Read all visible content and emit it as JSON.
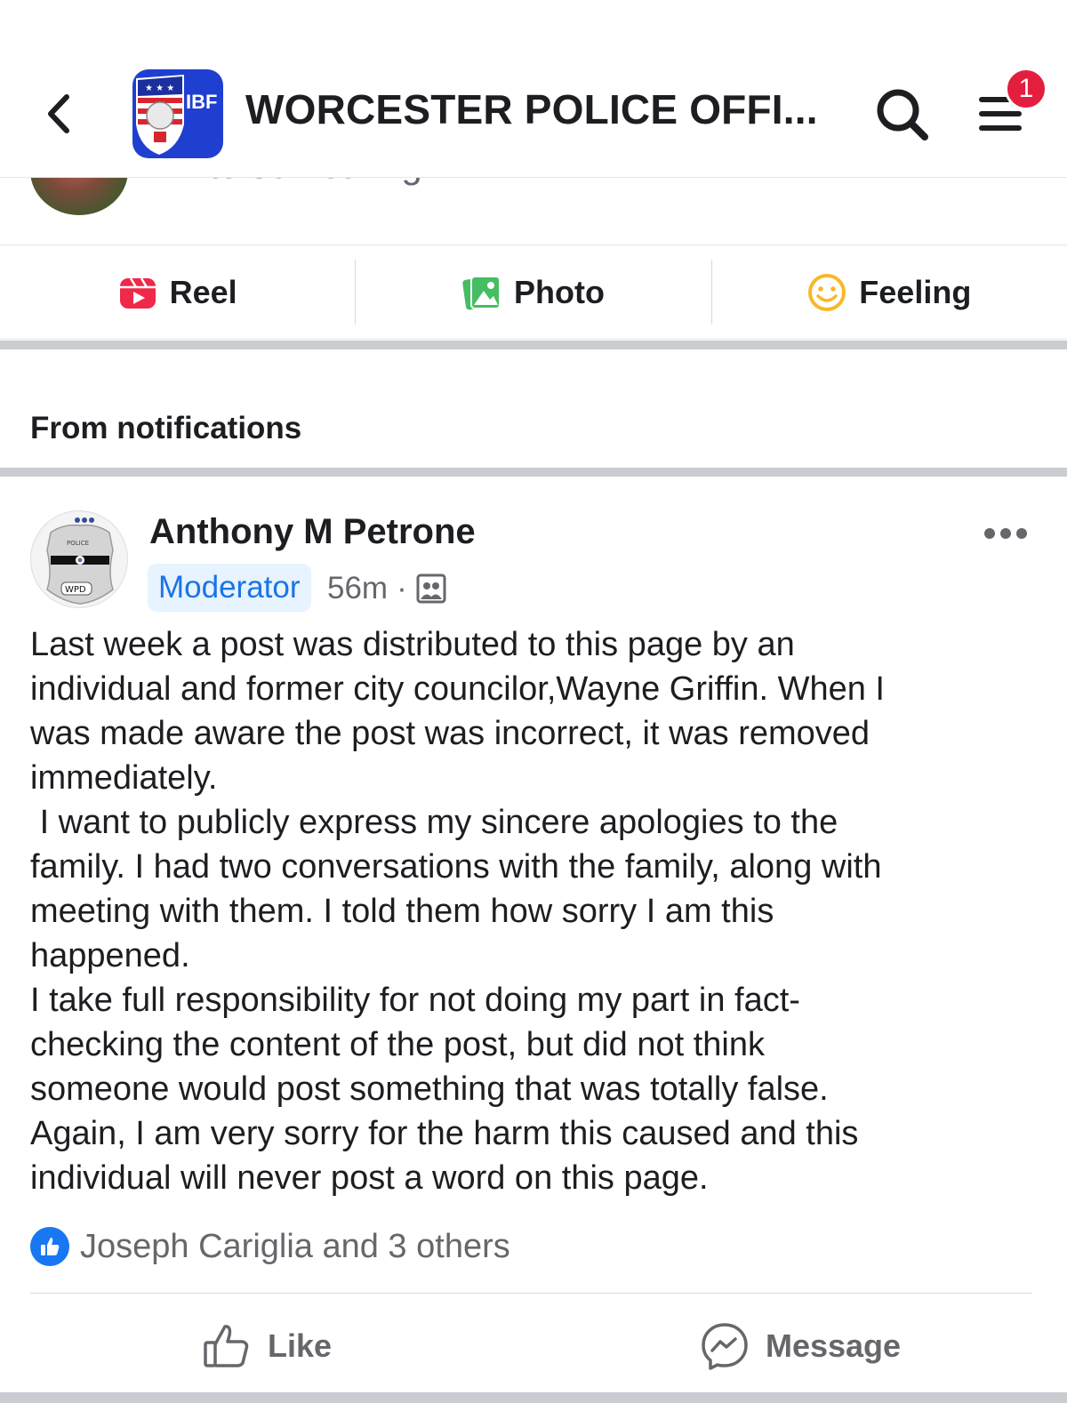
{
  "header": {
    "back_icon": "chevron-left-icon",
    "group_logo_text": "IBF",
    "title": "WORCESTER POLICE OFFI...",
    "search_icon": "search-icon",
    "menu_icon": "menu-icon",
    "notification_count": "1"
  },
  "composer": {
    "placeholder": "Write something..."
  },
  "actions": [
    {
      "label": "Reel",
      "icon": "reel-icon"
    },
    {
      "label": "Photo",
      "icon": "photo-icon"
    },
    {
      "label": "Feeling",
      "icon": "feeling-icon"
    }
  ],
  "section": {
    "label": "From notifications"
  },
  "post": {
    "author": "Anthony M Petrone",
    "role": "Moderator",
    "time": "56m",
    "separator": "·",
    "avatar_badge_top": "POLICE",
    "avatar_badge_bottom": "WPD",
    "body": "Last week a post was distributed to this page by an\nindividual and former city councilor,Wayne Griffin. When I\nwas made aware the post was incorrect, it was removed\nimmediately.\n I want to publicly express my sincere apologies to the\nfamily. I had two conversations with the family, along with\nmeeting with them. I told them how sorry I am this\nhappened.\nI take full responsibility for not doing my part in fact-\nchecking the content of the post, but did not think\nsomeone would post something that was totally false.\nAgain, I am very sorry for the harm this caused and this\nindividual will never post a word on this page.",
    "reactions_text": "Joseph Cariglia and 3 others",
    "like_label": "Like",
    "message_label": "Message"
  },
  "colors": {
    "brand_blue": "#1877f2",
    "badge_red": "#e41e3f",
    "moderator_bg": "#e7f3ff",
    "moderator_text": "#1b74e4"
  }
}
